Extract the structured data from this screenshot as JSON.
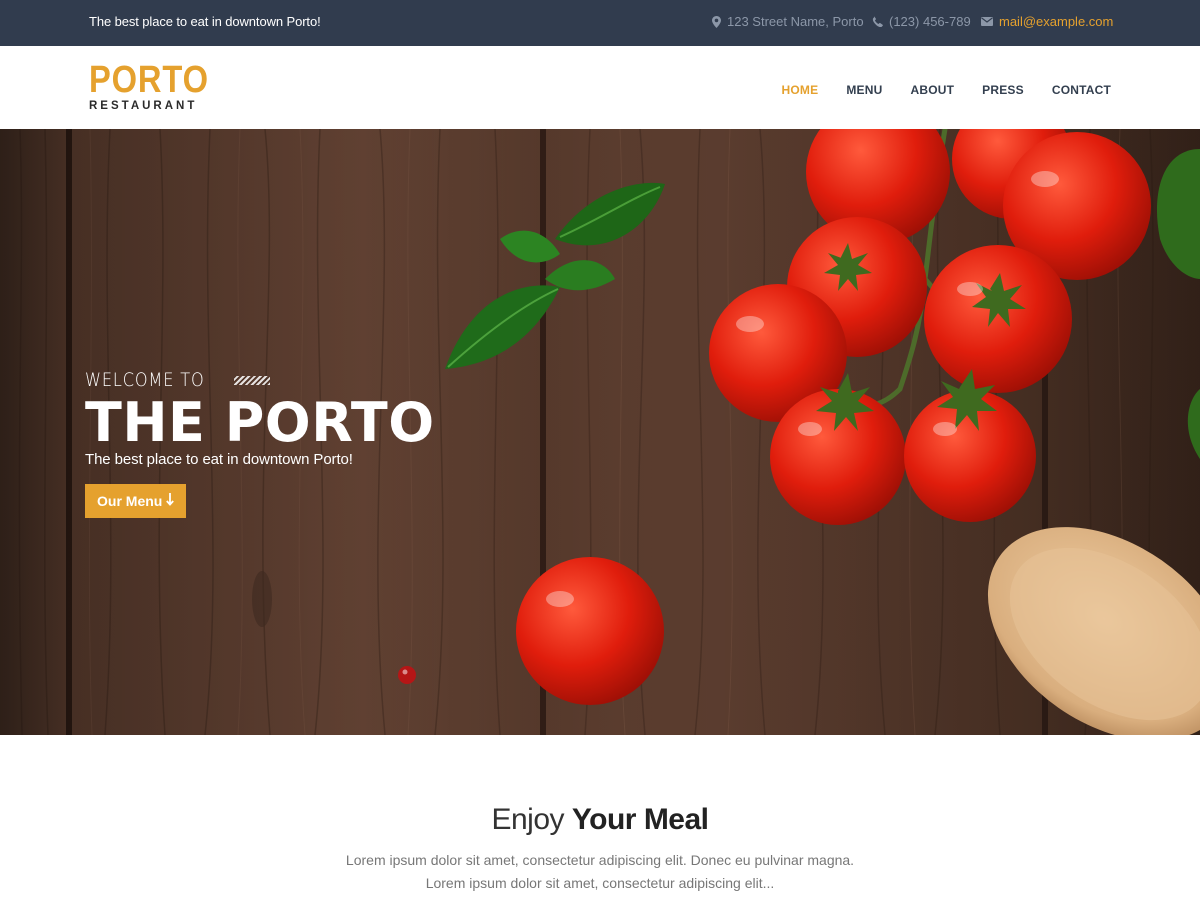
{
  "topbar": {
    "tagline": "The best place to eat in downtown Porto!",
    "address": "123 Street Name, Porto",
    "phone": "(123) 456-789",
    "email": "mail@example.com"
  },
  "header": {
    "logo_main": "PORTO",
    "logo_sub": "RESTAURANT",
    "nav": [
      {
        "label": "HOME",
        "active": true
      },
      {
        "label": "MENU"
      },
      {
        "label": "ABOUT"
      },
      {
        "label": "PRESS"
      },
      {
        "label": "CONTACT"
      }
    ]
  },
  "hero": {
    "welcome": "WELCOME TO",
    "title": "THE PORTO",
    "subtitle": "The best place to eat in downtown Porto!",
    "button_label": "Our Menu"
  },
  "intro": {
    "title_light": "Enjoy",
    "title_bold": "Your Meal",
    "line1": "Lorem ipsum dolor sit amet, consectetur adipiscing elit. Donec eu pulvinar magna.",
    "line2": "Lorem ipsum dolor sit amet, consectetur adipiscing elit..."
  },
  "colors": {
    "accent": "#e5a12e",
    "topbar_bg": "#313c4e",
    "nav_text": "#333f4f"
  },
  "icons": [
    "map-marker-icon",
    "phone-icon",
    "envelope-icon",
    "arrow-down-icon"
  ]
}
